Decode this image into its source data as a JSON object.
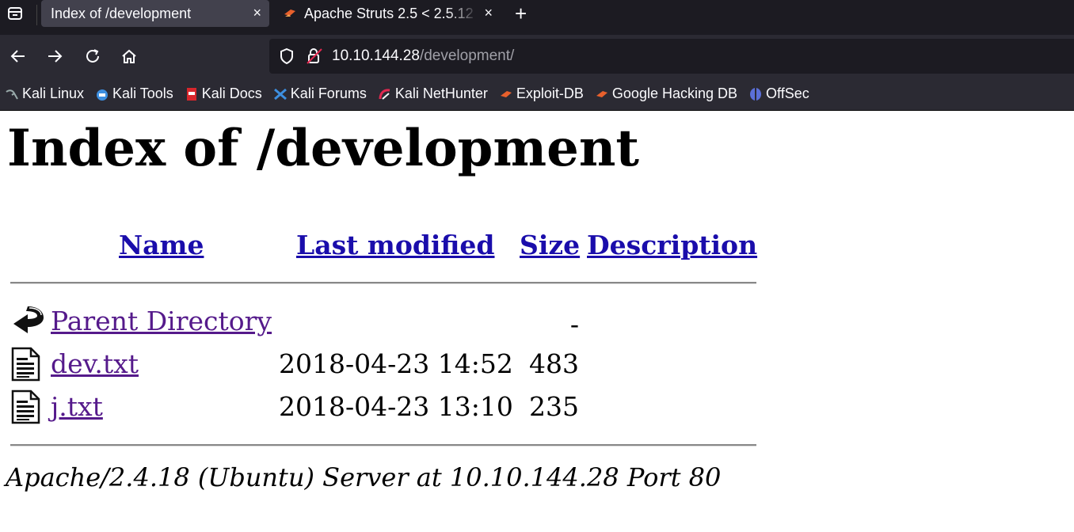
{
  "browser": {
    "tabs": [
      {
        "title": "Index of /development",
        "active": true
      },
      {
        "title": "Apache Struts 2.5 < 2.5.12",
        "active": false
      }
    ],
    "tab_close_glyph": "×",
    "new_tab_glyph": "+",
    "url": {
      "host": "10.10.144.28",
      "path": "/development/"
    },
    "bookmarks": [
      {
        "label": "Kali Linux",
        "icon": "kali-linux-icon"
      },
      {
        "label": "Kali Tools",
        "icon": "kali-tools-icon"
      },
      {
        "label": "Kali Docs",
        "icon": "kali-docs-icon"
      },
      {
        "label": "Kali Forums",
        "icon": "kali-forums-icon"
      },
      {
        "label": "Kali NetHunter",
        "icon": "kali-nethunter-icon"
      },
      {
        "label": "Exploit-DB",
        "icon": "exploit-db-icon"
      },
      {
        "label": "Google Hacking DB",
        "icon": "google-hacking-db-icon"
      },
      {
        "label": "OffSec",
        "icon": "offsec-icon"
      }
    ]
  },
  "page": {
    "title": "Index of /development",
    "columns": {
      "name": "Name",
      "last_modified": "Last modified",
      "size": "Size",
      "description": "Description"
    },
    "rows": [
      {
        "name": "Parent Directory",
        "date": "",
        "size": "-",
        "icon": "parent-directory-icon"
      },
      {
        "name": "dev.txt",
        "date": "2018-04-23 14:52",
        "size": "483",
        "icon": "text-file-icon"
      },
      {
        "name": "j.txt",
        "date": "2018-04-23 13:10",
        "size": "235",
        "icon": "text-file-icon"
      }
    ],
    "address": "Apache/2.4.18 (Ubuntu) Server at 10.10.144.28 Port 80"
  },
  "colors": {
    "link": "#1a0dab",
    "visited": "#551a8b",
    "chrome_dark": "#1c1b22",
    "chrome": "#2b2a33"
  }
}
